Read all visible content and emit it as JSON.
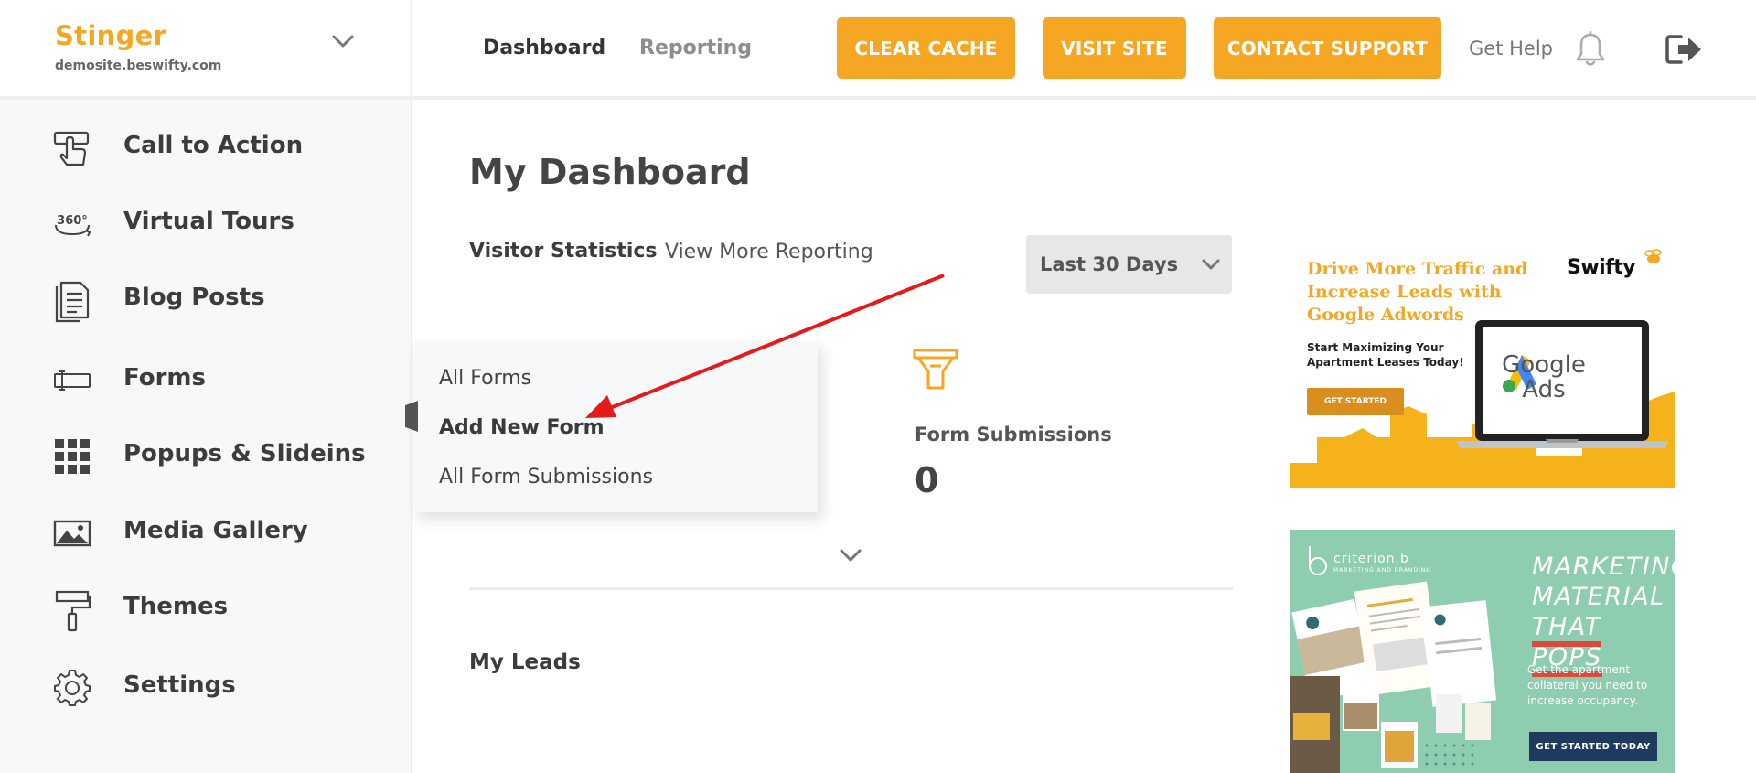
{
  "brand": {
    "name": "Stinger",
    "domain": "demosite.beswifty.com"
  },
  "topnav": {
    "tabs": [
      {
        "label": "Dashboard",
        "active": true
      },
      {
        "label": "Reporting",
        "active": false
      }
    ],
    "buttons": {
      "clear_cache": "CLEAR CACHE",
      "visit_site": "VISIT SITE",
      "contact_support": "CONTACT SUPPORT"
    },
    "get_help": "Get Help",
    "accent_color": "#f5a623"
  },
  "sidebar": {
    "items": [
      {
        "label": "Call to Action",
        "icon": "hand-pointer-icon"
      },
      {
        "label": "Virtual Tours",
        "icon": "360-icon"
      },
      {
        "label": "Blog Posts",
        "icon": "document-icon"
      },
      {
        "label": "Forms",
        "icon": "form-field-icon"
      },
      {
        "label": "Popups & Slideins",
        "icon": "grid-icon"
      },
      {
        "label": "Media Gallery",
        "icon": "image-icon"
      },
      {
        "label": "Themes",
        "icon": "paint-roller-icon"
      },
      {
        "label": "Settings",
        "icon": "gear-icon"
      }
    ]
  },
  "flyout": {
    "items": [
      {
        "label": "All Forms",
        "highlighted": false
      },
      {
        "label": "Add New Form",
        "highlighted": true
      },
      {
        "label": "All Form Submissions",
        "highlighted": false
      }
    ]
  },
  "main": {
    "title": "My Dashboard",
    "visitor_statistics": "Visitor Statistics",
    "view_more_reporting": "View More Reporting",
    "date_range": {
      "selected": "Last 30 Days"
    },
    "stats": [
      {
        "label": "Form Submissions",
        "value": "0",
        "icon": "funnel-icon"
      }
    ],
    "my_leads": "My Leads"
  },
  "ads": {
    "adwords": {
      "headline": "Drive More Traffic and Increase Leads with Google Adwords",
      "subline": "Start Maximizing Your Apartment Leases Today!",
      "button": "GET STARTED",
      "logo": "Swifty",
      "product_line1": "Google",
      "product_line2": "Ads"
    },
    "criterion": {
      "brand": "criterion.b",
      "brand_sub": "MARKETING AND BRANDING",
      "headline_line1": "MARKETING",
      "headline_line2": "MATERIAL",
      "headline_line3": "THAT POPS",
      "body": "Get the apartment collateral you need to increase occupancy.",
      "button": "GET STARTED TODAY"
    }
  }
}
